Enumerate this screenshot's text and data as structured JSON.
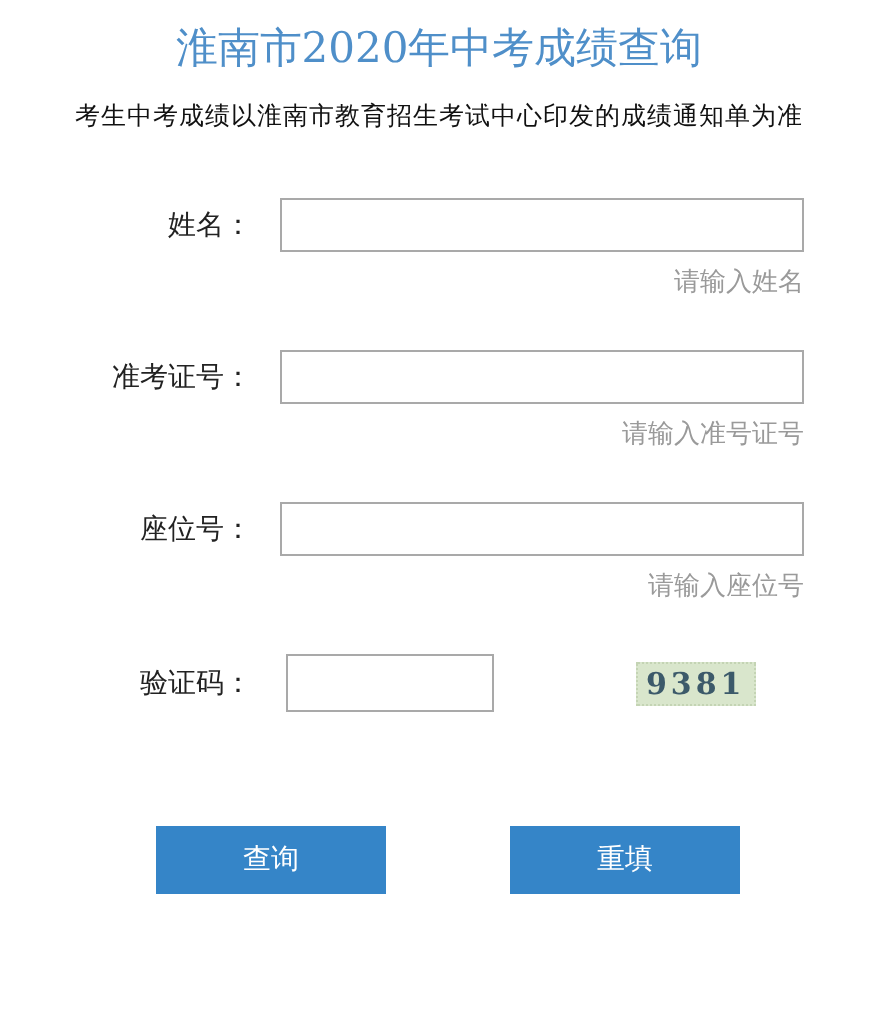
{
  "title": "淮南市2020年中考成绩查询",
  "notice": "考生中考成绩以淮南市教育招生考试中心印发的成绩通知单为准",
  "fields": [
    {
      "label": "姓名：",
      "hint": "请输入姓名"
    },
    {
      "label": "准考证号：",
      "hint": "请输入准号证号"
    },
    {
      "label": "座位号：",
      "hint": "请输入座位号"
    }
  ],
  "captcha": {
    "label": "验证码：",
    "code": "9381"
  },
  "buttons": [
    "查询",
    "重填"
  ]
}
